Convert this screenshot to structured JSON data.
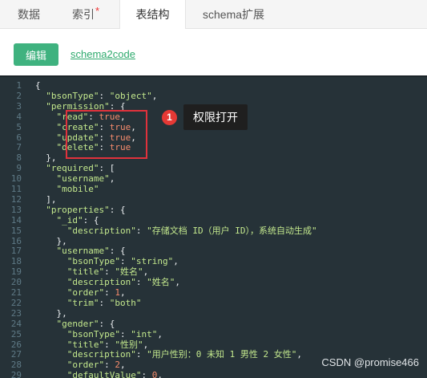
{
  "tabs": [
    {
      "label": "数据",
      "active": false
    },
    {
      "label": "索引",
      "active": false,
      "marker": "*"
    },
    {
      "label": "表结构",
      "active": true
    },
    {
      "label": "schema扩展",
      "active": false
    }
  ],
  "toolbar": {
    "edit_label": "编辑",
    "link_label": "schema2code"
  },
  "annotation": {
    "number": "1",
    "label": "权限打开"
  },
  "watermark": "CSDN @promise466",
  "code_lines": [
    {
      "n": "1",
      "t": "{"
    },
    {
      "n": "2",
      "t": "  \"bsonType\": \"object\","
    },
    {
      "n": "3",
      "t": "  \"permission\": {"
    },
    {
      "n": "4",
      "t": "    \"read\": true,"
    },
    {
      "n": "5",
      "t": "    \"create\": true,"
    },
    {
      "n": "6",
      "t": "    \"update\": true,"
    },
    {
      "n": "7",
      "t": "    \"delete\": true"
    },
    {
      "n": "8",
      "t": "  },"
    },
    {
      "n": "9",
      "t": "  \"required\": ["
    },
    {
      "n": "10",
      "t": "    \"username\","
    },
    {
      "n": "11",
      "t": "    \"mobile\""
    },
    {
      "n": "12",
      "t": "  ],"
    },
    {
      "n": "13",
      "t": "  \"properties\": {"
    },
    {
      "n": "14",
      "t": "    \"_id\": {"
    },
    {
      "n": "15",
      "t": "      \"description\": \"存储文档 ID（用户 ID），系统自动生成\""
    },
    {
      "n": "16",
      "t": "    },"
    },
    {
      "n": "17",
      "t": "    \"username\": {"
    },
    {
      "n": "18",
      "t": "      \"bsonType\": \"string\","
    },
    {
      "n": "19",
      "t": "      \"title\": \"姓名\","
    },
    {
      "n": "20",
      "t": "      \"description\": \"姓名\","
    },
    {
      "n": "21",
      "t": "      \"order\": 1,"
    },
    {
      "n": "22",
      "t": "      \"trim\": \"both\""
    },
    {
      "n": "23",
      "t": "    },"
    },
    {
      "n": "24",
      "t": "    \"gender\": {"
    },
    {
      "n": "25",
      "t": "      \"bsonType\": \"int\","
    },
    {
      "n": "26",
      "t": "      \"title\": \"性别\","
    },
    {
      "n": "27",
      "t": "      \"description\": \"用户性别：0 未知 1 男性 2 女性\","
    },
    {
      "n": "28",
      "t": "      \"order\": 2,"
    },
    {
      "n": "29",
      "t": "      \"defaultValue\": 0,"
    }
  ],
  "colors": {
    "accent": "#3fb27f",
    "editor_bg": "#263238",
    "highlight": "#e0323c"
  }
}
